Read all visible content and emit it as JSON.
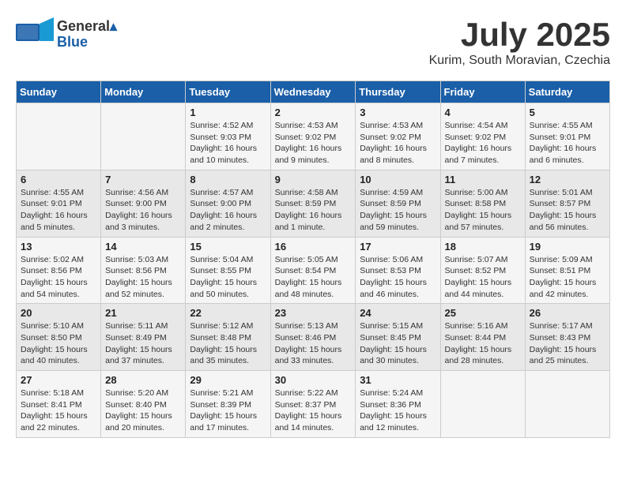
{
  "header": {
    "logo_general": "General",
    "logo_blue": "Blue",
    "title": "July 2025",
    "subtitle": "Kurim, South Moravian, Czechia"
  },
  "weekdays": [
    "Sunday",
    "Monday",
    "Tuesday",
    "Wednesday",
    "Thursday",
    "Friday",
    "Saturday"
  ],
  "weeks": [
    [
      {
        "day": "",
        "info": ""
      },
      {
        "day": "",
        "info": ""
      },
      {
        "day": "1",
        "info": "Sunrise: 4:52 AM\nSunset: 9:03 PM\nDaylight: 16 hours and 10 minutes."
      },
      {
        "day": "2",
        "info": "Sunrise: 4:53 AM\nSunset: 9:02 PM\nDaylight: 16 hours and 9 minutes."
      },
      {
        "day": "3",
        "info": "Sunrise: 4:53 AM\nSunset: 9:02 PM\nDaylight: 16 hours and 8 minutes."
      },
      {
        "day": "4",
        "info": "Sunrise: 4:54 AM\nSunset: 9:02 PM\nDaylight: 16 hours and 7 minutes."
      },
      {
        "day": "5",
        "info": "Sunrise: 4:55 AM\nSunset: 9:01 PM\nDaylight: 16 hours and 6 minutes."
      }
    ],
    [
      {
        "day": "6",
        "info": "Sunrise: 4:55 AM\nSunset: 9:01 PM\nDaylight: 16 hours and 5 minutes."
      },
      {
        "day": "7",
        "info": "Sunrise: 4:56 AM\nSunset: 9:00 PM\nDaylight: 16 hours and 3 minutes."
      },
      {
        "day": "8",
        "info": "Sunrise: 4:57 AM\nSunset: 9:00 PM\nDaylight: 16 hours and 2 minutes."
      },
      {
        "day": "9",
        "info": "Sunrise: 4:58 AM\nSunset: 8:59 PM\nDaylight: 16 hours and 1 minute."
      },
      {
        "day": "10",
        "info": "Sunrise: 4:59 AM\nSunset: 8:59 PM\nDaylight: 15 hours and 59 minutes."
      },
      {
        "day": "11",
        "info": "Sunrise: 5:00 AM\nSunset: 8:58 PM\nDaylight: 15 hours and 57 minutes."
      },
      {
        "day": "12",
        "info": "Sunrise: 5:01 AM\nSunset: 8:57 PM\nDaylight: 15 hours and 56 minutes."
      }
    ],
    [
      {
        "day": "13",
        "info": "Sunrise: 5:02 AM\nSunset: 8:56 PM\nDaylight: 15 hours and 54 minutes."
      },
      {
        "day": "14",
        "info": "Sunrise: 5:03 AM\nSunset: 8:56 PM\nDaylight: 15 hours and 52 minutes."
      },
      {
        "day": "15",
        "info": "Sunrise: 5:04 AM\nSunset: 8:55 PM\nDaylight: 15 hours and 50 minutes."
      },
      {
        "day": "16",
        "info": "Sunrise: 5:05 AM\nSunset: 8:54 PM\nDaylight: 15 hours and 48 minutes."
      },
      {
        "day": "17",
        "info": "Sunrise: 5:06 AM\nSunset: 8:53 PM\nDaylight: 15 hours and 46 minutes."
      },
      {
        "day": "18",
        "info": "Sunrise: 5:07 AM\nSunset: 8:52 PM\nDaylight: 15 hours and 44 minutes."
      },
      {
        "day": "19",
        "info": "Sunrise: 5:09 AM\nSunset: 8:51 PM\nDaylight: 15 hours and 42 minutes."
      }
    ],
    [
      {
        "day": "20",
        "info": "Sunrise: 5:10 AM\nSunset: 8:50 PM\nDaylight: 15 hours and 40 minutes."
      },
      {
        "day": "21",
        "info": "Sunrise: 5:11 AM\nSunset: 8:49 PM\nDaylight: 15 hours and 37 minutes."
      },
      {
        "day": "22",
        "info": "Sunrise: 5:12 AM\nSunset: 8:48 PM\nDaylight: 15 hours and 35 minutes."
      },
      {
        "day": "23",
        "info": "Sunrise: 5:13 AM\nSunset: 8:46 PM\nDaylight: 15 hours and 33 minutes."
      },
      {
        "day": "24",
        "info": "Sunrise: 5:15 AM\nSunset: 8:45 PM\nDaylight: 15 hours and 30 minutes."
      },
      {
        "day": "25",
        "info": "Sunrise: 5:16 AM\nSunset: 8:44 PM\nDaylight: 15 hours and 28 minutes."
      },
      {
        "day": "26",
        "info": "Sunrise: 5:17 AM\nSunset: 8:43 PM\nDaylight: 15 hours and 25 minutes."
      }
    ],
    [
      {
        "day": "27",
        "info": "Sunrise: 5:18 AM\nSunset: 8:41 PM\nDaylight: 15 hours and 22 minutes."
      },
      {
        "day": "28",
        "info": "Sunrise: 5:20 AM\nSunset: 8:40 PM\nDaylight: 15 hours and 20 minutes."
      },
      {
        "day": "29",
        "info": "Sunrise: 5:21 AM\nSunset: 8:39 PM\nDaylight: 15 hours and 17 minutes."
      },
      {
        "day": "30",
        "info": "Sunrise: 5:22 AM\nSunset: 8:37 PM\nDaylight: 15 hours and 14 minutes."
      },
      {
        "day": "31",
        "info": "Sunrise: 5:24 AM\nSunset: 8:36 PM\nDaylight: 15 hours and 12 minutes."
      },
      {
        "day": "",
        "info": ""
      },
      {
        "day": "",
        "info": ""
      }
    ]
  ]
}
